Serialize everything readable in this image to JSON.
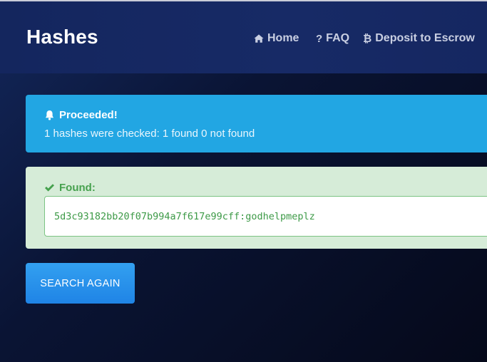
{
  "header": {
    "brand": "Hashes",
    "nav": [
      {
        "label": "Home",
        "icon": "home-icon"
      },
      {
        "label": "FAQ",
        "icon": "question-icon"
      },
      {
        "label": "Deposit to Escrow",
        "icon": "bitcoin-icon"
      }
    ]
  },
  "info_alert": {
    "icon": "bell-icon",
    "title": "Proceeded!",
    "message": "1 hashes were checked: 1 found 0 not found"
  },
  "success_alert": {
    "icon": "check-icon",
    "title": "Found:",
    "result": "5d3c93182bb20f07b994a7f617e99cff:godhelpmeplz"
  },
  "actions": {
    "search_again": "SEARCH AGAIN"
  },
  "colors": {
    "info": "#22a6e3",
    "success_bg": "#d6ecd8",
    "success_text": "#46a14e",
    "button": "#2690ec"
  }
}
